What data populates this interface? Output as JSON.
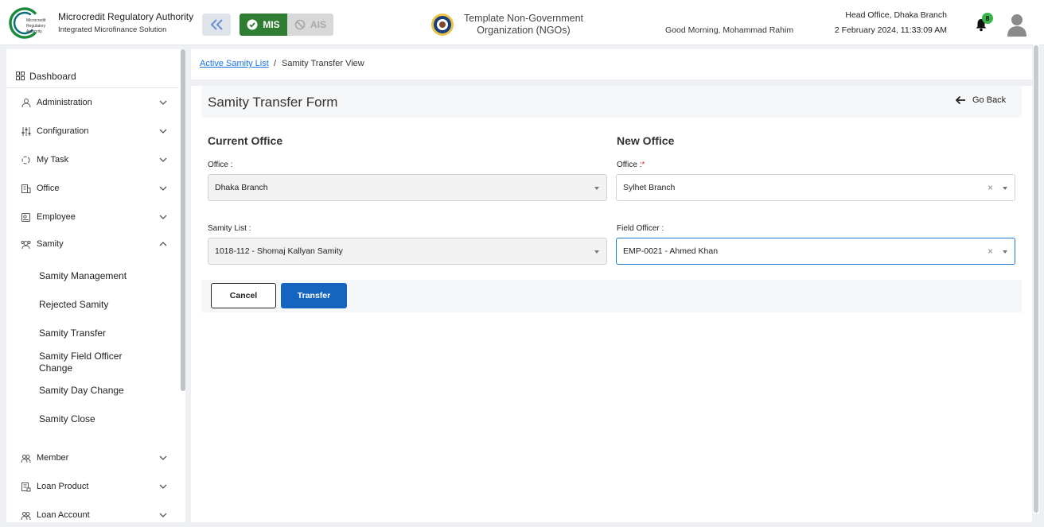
{
  "header": {
    "brand_title": "Microcredit Regulatory Authority",
    "brand_subtitle": "Integrated Microfinance Solution",
    "logo_text": [
      "Microcredit",
      "Regulatory",
      "Authority"
    ],
    "module_mis": "MIS",
    "module_ais": "AIS",
    "org_name_line1": "Template Non-Government",
    "org_name_line2": "Organization (NGOs)",
    "greeting": "Good Morning, Mohammad Rahim",
    "office": "Head Office, Dhaka Branch",
    "datetime": "2 February 2024, 11:33:09 AM",
    "notification_count": "8",
    "colors": {
      "mis_active": "#2e7d32",
      "brand_green": "#1b8a3c",
      "brand_teal": "#0a6e7a"
    }
  },
  "sidebar": {
    "dashboard": "Dashboard",
    "items": [
      {
        "label": "Administration",
        "icon": "admin-icon"
      },
      {
        "label": "Configuration",
        "icon": "sliders-icon"
      },
      {
        "label": "My Task",
        "icon": "task-icon"
      },
      {
        "label": "Office",
        "icon": "office-icon"
      },
      {
        "label": "Employee",
        "icon": "employee-icon"
      },
      {
        "label": "Samity",
        "icon": "samity-icon"
      },
      {
        "label": "Member",
        "icon": "member-icon"
      },
      {
        "label": "Loan Product",
        "icon": "loan-product-icon"
      },
      {
        "label": "Loan Account",
        "icon": "loan-account-icon"
      }
    ],
    "samity_sub": [
      "Samity Management",
      "Rejected Samity",
      "Samity Transfer",
      "Samity Field Officer Change",
      "Samity Day Change",
      "Samity Close"
    ]
  },
  "breadcrumb": {
    "link": "Active Samity List",
    "separator": "/",
    "current": "Samity Transfer View"
  },
  "form": {
    "title": "Samity Transfer Form",
    "go_back": "Go Back",
    "current": {
      "title": "Current Office",
      "office_label": "Office :",
      "office_value": "Dhaka Branch",
      "samity_label": "Samity List :",
      "samity_value": "1018-112 - Shomaj Kallyan Samity"
    },
    "new": {
      "title": "New Office",
      "office_label": "Office :",
      "required_mark": "*",
      "office_value": "Sylhet Branch",
      "officer_label": "Field Officer :",
      "officer_value": "EMP-0021 - Ahmed Khan",
      "clear_symbol": "×"
    },
    "cancel": "Cancel",
    "transfer": "Transfer"
  }
}
